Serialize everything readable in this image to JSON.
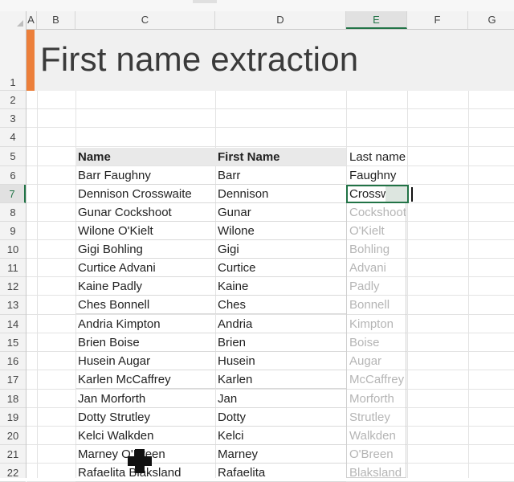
{
  "columns": [
    "A",
    "B",
    "C",
    "D",
    "E",
    "F",
    "G"
  ],
  "rows": [
    "1",
    "2",
    "3",
    "4",
    "5",
    "6",
    "7",
    "8",
    "9",
    "10",
    "11",
    "12",
    "13",
    "14",
    "15",
    "16",
    "17",
    "18",
    "19",
    "20",
    "21",
    "22"
  ],
  "title": "First name extraction",
  "table": {
    "headers": [
      "Name",
      "First Name",
      "Last name"
    ],
    "rows": [
      {
        "name": "Barr Faughny",
        "first": "Barr",
        "last": "Faughny"
      },
      {
        "name": "Dennison Crosswaite",
        "first": "Dennison",
        "last": "Crosswaite"
      },
      {
        "name": "Gunar Cockshoot",
        "first": "Gunar",
        "last": "Cockshoot"
      },
      {
        "name": "Wilone O'Kielt",
        "first": "Wilone",
        "last": "O'Kielt"
      },
      {
        "name": "Gigi Bohling",
        "first": "Gigi",
        "last": "Bohling"
      },
      {
        "name": "Curtice Advani",
        "first": "Curtice",
        "last": "Advani"
      },
      {
        "name": "Kaine Padly",
        "first": "Kaine",
        "last": "Padly"
      },
      {
        "name": "Ches Bonnell",
        "first": "Ches",
        "last": "Bonnell"
      },
      {
        "name": "Andria Kimpton",
        "first": "Andria",
        "last": "Kimpton"
      },
      {
        "name": "Brien Boise",
        "first": "Brien",
        "last": "Boise"
      },
      {
        "name": "Husein Augar",
        "first": "Husein",
        "last": "Augar"
      },
      {
        "name": "Karlen McCaffrey",
        "first": "Karlen",
        "last": "McCaffrey"
      },
      {
        "name": "Jan Morforth",
        "first": "Jan",
        "last": "Morforth"
      },
      {
        "name": "Dotty Strutley",
        "first": "Dotty",
        "last": "Strutley"
      },
      {
        "name": "Kelci Walkden",
        "first": "Kelci",
        "last": "Walkden"
      },
      {
        "name": "Marney O'Breen",
        "first": "Marney",
        "last": "O'Breen"
      },
      {
        "name": "Rafaelita Blaksland",
        "first": "Rafaelita",
        "last": "Blaksland"
      }
    ]
  },
  "selection": {
    "column": "E",
    "row": "7"
  },
  "colors": {
    "accent": "#ec7f3a",
    "selection": "#217346",
    "ghost_text": "#b5b5b5"
  }
}
